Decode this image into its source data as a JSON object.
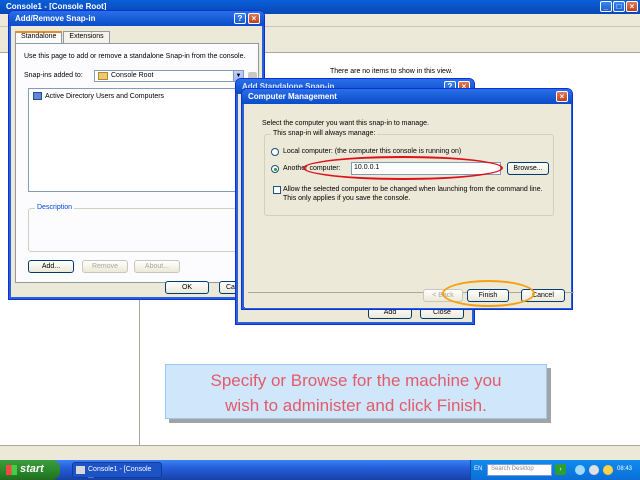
{
  "console": {
    "title": "Console1 - [Console Root]",
    "empty_message": "There are no items to show in this view."
  },
  "snapin_dialog": {
    "title": "Add/Remove Snap-in",
    "tabs": [
      "Standalone",
      "Extensions"
    ],
    "intro_text": "Use this page to add or remove a standalone Snap-in from the console.",
    "added_to_label": "Snap-ins added to:",
    "added_to_value": "Console Root",
    "list_items": [
      "Active Directory Users and Computers"
    ],
    "description_label": "Description",
    "buttons": {
      "add": "Add...",
      "remove": "Remove",
      "about": "About...",
      "ok": "OK",
      "cancel": "Ca"
    }
  },
  "wizard_dialog": {
    "title": "Add Standalone Snap-in",
    "buttons": {
      "add": "Add",
      "close": "Close"
    }
  },
  "cm_dialog": {
    "title": "Computer Management",
    "instruction": "Select the computer you want this snap-in to manage.",
    "group_label": "This snap-in will always manage:",
    "local_option": "Local computer:  (the computer this console is running on)",
    "another_option": "Another computer:",
    "computer_value": "10.0.0.1",
    "browse_button": "Browse...",
    "checkbox_text": "Allow the selected computer to be changed when launching from the command line.  This only applies if you save the console.",
    "buttons": {
      "back": "< Back",
      "finish": "Finish",
      "cancel": "Cancel"
    },
    "another_selected": true,
    "allow_change_checked": false
  },
  "caption": {
    "line1": "Specify or Browse for the machine you",
    "line2": "wish to administer and click Finish."
  },
  "taskbar": {
    "start_label": "start",
    "task_label": "Console1 - [Console ...",
    "language": "EN",
    "search_placeholder": "Search Desktop",
    "clock": "08:43"
  },
  "colors": {
    "annotation_red": "#e0101a",
    "annotation_orange": "#f5a010",
    "caption_text": "#e45a6a",
    "caption_bg": "#cfe6fb"
  }
}
